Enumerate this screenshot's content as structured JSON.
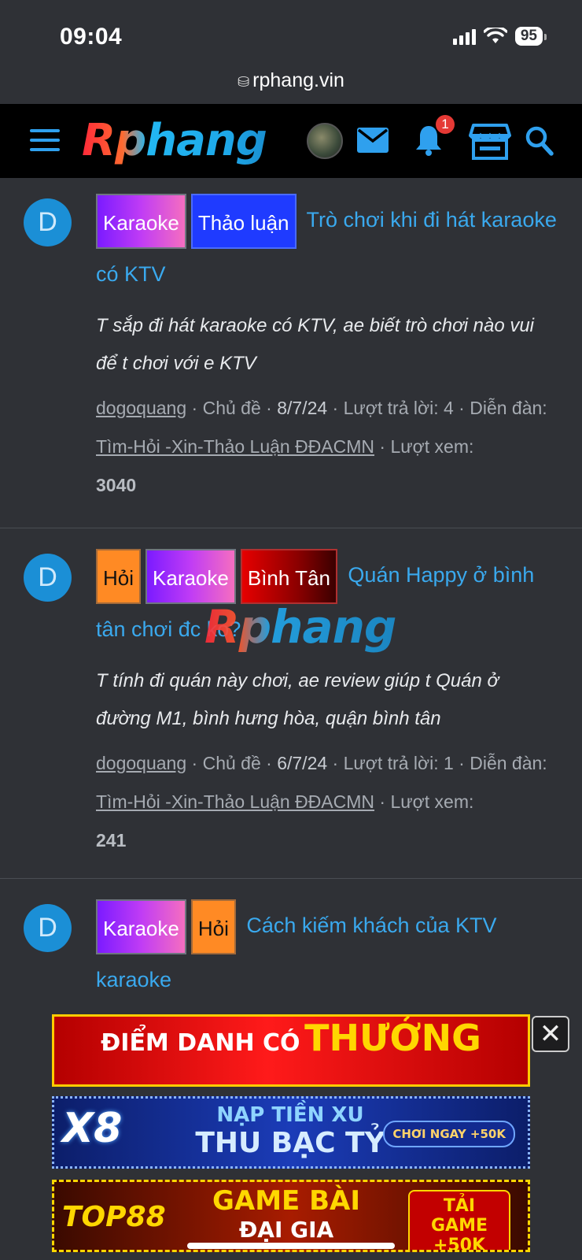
{
  "status": {
    "time": "09:04",
    "battery": "95"
  },
  "browser": {
    "url": "rphang.vin"
  },
  "header": {
    "logo": "Rphang",
    "notification_count": "1"
  },
  "threads": [
    {
      "avatar": "D",
      "prefixes": [
        "Karaoke",
        "Thảo luận"
      ],
      "title": "Trò chơi khi đi hát karaoke có KTV",
      "snippet": "T sắp đi hát karaoke có KTV, ae biết trò chơi nào vui để t chơi với e KTV",
      "user": "dogoquang",
      "type_label": "Chủ đề",
      "date": "8/7/24",
      "replies_label": "Lượt trả lời: 4",
      "forum_label": "Diễn đàn:",
      "forum": "Tìm-Hỏi -Xin-Thảo Luận ĐĐACMN",
      "views_label": "Lượt xem:",
      "views": "3040"
    },
    {
      "avatar": "D",
      "prefixes": [
        "Hỏi",
        "Karaoke",
        "Bình Tân"
      ],
      "title": "Quán Happy ở bình tân chơi đc ko?",
      "snippet": "T tính đi quán này chơi, ae review giúp t Quán ở đường M1, bình hưng hòa, quận bình tân",
      "user": "dogoquang",
      "type_label": "Chủ đề",
      "date": "6/7/24",
      "replies_label": "Lượt trả lời: 1",
      "forum_label": "Diễn đàn:",
      "forum": "Tìm-Hỏi -Xin-Thảo Luận ĐĐACMN",
      "views_label": "Lượt xem:",
      "views": "241"
    },
    {
      "avatar": "D",
      "prefixes": [
        "Karaoke",
        "Hỏi"
      ],
      "title": "Cách kiếm khách của KTV karaoke"
    }
  ],
  "watermark": "Rphang",
  "ads": {
    "ad1_line1": "ĐIỂM DANH CÓ",
    "ad1_line2": "THƯỞNG",
    "ad2_brand": "X8",
    "ad2_line1": "NẠP TIỀN XU",
    "ad2_line2": "THU BẠC TỶ",
    "ad2_cta": "CHƠI NGAY +50K",
    "ad3_brand": "TOP88",
    "ad3_line1": "GAME BÀI",
    "ad3_line2": "ĐẠI GIA",
    "ad3_cta": "TẢI GAME +50K",
    "close": "✕"
  },
  "colors": {
    "accent": "#2fa0ee",
    "background": "#2f3136",
    "header": "#000000"
  },
  "icons": [
    "hamburger-icon",
    "mail-icon",
    "bell-icon",
    "store-icon",
    "search-icon",
    "incognito-icon"
  ]
}
